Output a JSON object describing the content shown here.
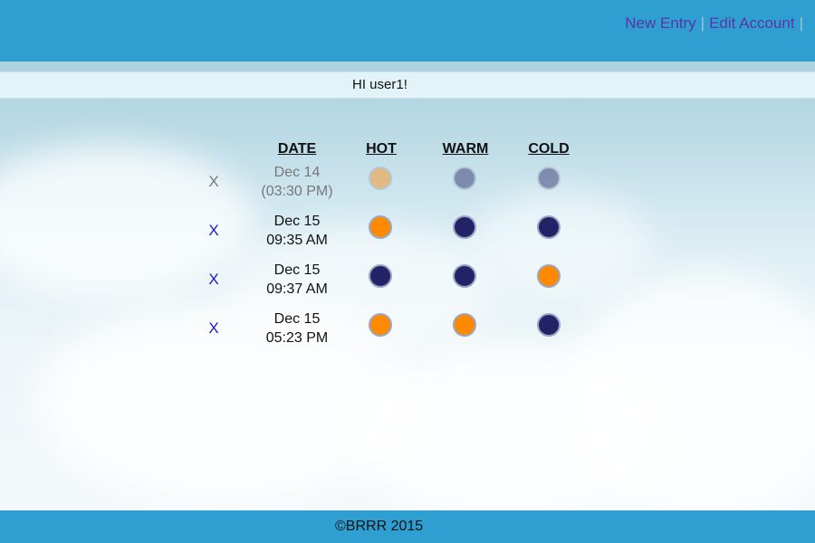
{
  "nav": {
    "new_entry": "New Entry",
    "separator": "|",
    "edit_account": "Edit Account"
  },
  "greeting": "HI user1!",
  "columns": {
    "date": "DATE",
    "hot": "HOT",
    "warm": "WARM",
    "cold": "COLD"
  },
  "colors": {
    "orange": "#ff8a00",
    "navy": "#242266",
    "topbar": "#2f9fd2"
  },
  "entries": [
    {
      "delete_label": "X",
      "date_line1": "Dec 14",
      "date_line2": "(03:30 PM)",
      "hot": "orange",
      "warm": "navy",
      "cold": "navy",
      "faded": true
    },
    {
      "delete_label": "X",
      "date_line1": "Dec 15",
      "date_line2": "09:35 AM",
      "hot": "orange",
      "warm": "navy",
      "cold": "navy",
      "faded": false
    },
    {
      "delete_label": "X",
      "date_line1": "Dec 15",
      "date_line2": "09:37 AM",
      "hot": "navy",
      "warm": "navy",
      "cold": "orange",
      "faded": false
    },
    {
      "delete_label": "X",
      "date_line1": "Dec 15",
      "date_line2": "05:23 PM",
      "hot": "orange",
      "warm": "orange",
      "cold": "navy",
      "faded": false
    }
  ],
  "footer": "©BRRR 2015"
}
